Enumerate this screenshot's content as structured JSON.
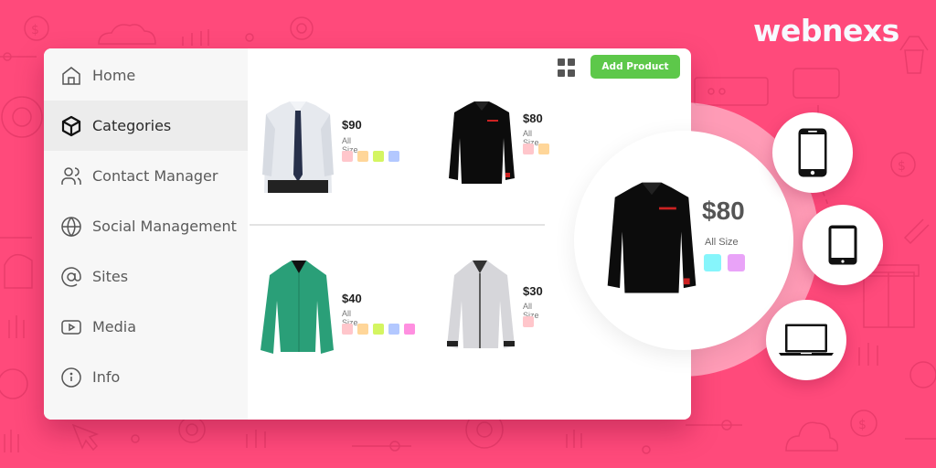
{
  "brand": {
    "name": "webnexs"
  },
  "sidebar": {
    "items": [
      {
        "label": "Home",
        "icon": "home-icon",
        "active": false
      },
      {
        "label": "Categories",
        "icon": "cube-icon",
        "active": true
      },
      {
        "label": "Contact Manager",
        "icon": "users-icon",
        "active": false
      },
      {
        "label": "Social Management",
        "icon": "globe-icon",
        "active": false
      },
      {
        "label": "Sites",
        "icon": "at-sign-icon",
        "active": false
      },
      {
        "label": "Media",
        "icon": "play-icon",
        "active": false
      },
      {
        "label": "Info",
        "icon": "info-icon",
        "active": false
      }
    ]
  },
  "toolbar": {
    "grid_view_icon": "grid-icon",
    "add_product_label": "Add Product",
    "add_product_color": "#5dc84a"
  },
  "products": [
    {
      "name": "white-shirt-with-tie",
      "price": "$90",
      "size": "All Size",
      "swatches": [
        "#ffc6cb",
        "#ffd699",
        "#d4f561",
        "#b3c8ff"
      ]
    },
    {
      "name": "black-shirt",
      "price": "$80",
      "size": "All Size",
      "swatches": [
        "#ffc6cb",
        "#ffd699"
      ]
    },
    {
      "name": "green-shirt",
      "price": "$40",
      "size": "All Size",
      "swatches": [
        "#ffc6cb",
        "#ffd699",
        "#d4f561",
        "#b3c8ff",
        "#ff8fe0"
      ]
    },
    {
      "name": "grey-shirt",
      "price": "$30",
      "size": "All Size",
      "swatches": [
        "#ffc6cb"
      ]
    }
  ],
  "featured": {
    "name": "black-shirt",
    "price": "$80",
    "size": "All Size",
    "swatches": [
      "#86f5fb",
      "#e9a3f8"
    ]
  },
  "devices": [
    {
      "name": "smartphone-icon"
    },
    {
      "name": "tablet-icon"
    },
    {
      "name": "laptop-icon"
    }
  ],
  "colors": {
    "background": "#ff4a7b",
    "accent_green": "#5dc84a"
  }
}
